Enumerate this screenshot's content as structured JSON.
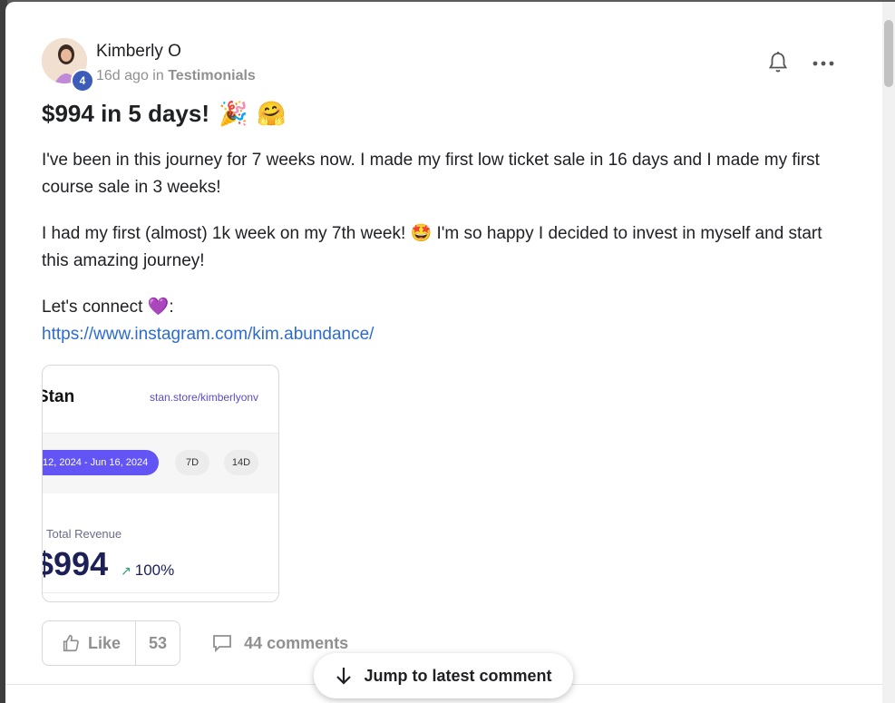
{
  "post": {
    "author": "Kimberly O",
    "level": "4",
    "time_ago": "16d ago",
    "in_word": "in",
    "category": "Testimonials",
    "title": "$994 in 5 days!",
    "title_emojis": [
      "🎉",
      "🤗"
    ],
    "paragraph1": "I've been in this journey for 7 weeks now. I made my first low ticket sale in 16 days and I made my first course sale in 3 weeks!",
    "paragraph2_a": "I had my first (almost) 1k week on my 7th week!",
    "paragraph2_emoji": "🤩",
    "paragraph2_b": "I'm so happy I decided to invest in myself and start this amazing journey!",
    "connect_label": "Let's connect",
    "connect_emoji": "💜",
    "connect_colon": ":",
    "link": "https://www.instagram.com/kim.abundance/"
  },
  "attachment": {
    "brand": "Stan",
    "url": "stan.store/kimberlyonv",
    "date_range": "12, 2024 - Jun 16, 2024",
    "chip_7d": "7D",
    "chip_14d": "14D",
    "revenue_label": "Total Revenue",
    "revenue_value": "$994",
    "growth": "100%"
  },
  "actions": {
    "like_label": "Like",
    "like_count": "53",
    "comments_label": "44 comments"
  },
  "jump_button": "Jump to latest comment",
  "icons": {
    "bell": "bell-off-icon",
    "more": "more-horizontal-icon",
    "like": "thumbs-up-icon",
    "comment": "comment-icon",
    "arrow": "arrow-down-icon"
  },
  "colors": {
    "link": "#2e6bd0",
    "stan_purple": "#6355f5",
    "badge": "#3d5bb8"
  }
}
